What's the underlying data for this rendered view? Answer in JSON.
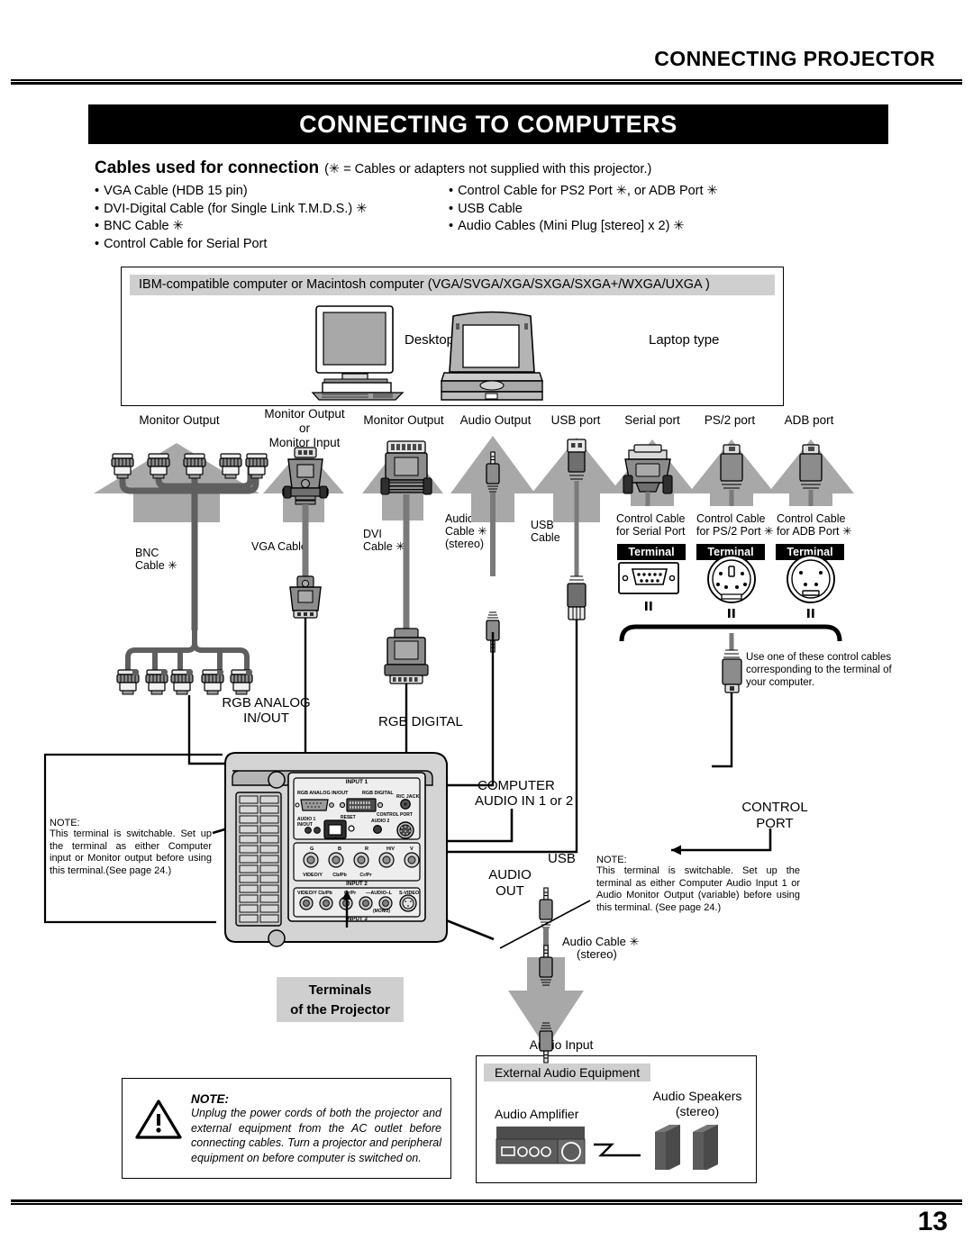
{
  "header": {
    "running_head": "CONNECTING PROJECTOR",
    "section_title": "CONNECTING TO COMPUTERS",
    "page_number": "13"
  },
  "cables": {
    "heading": "Cables used for connection",
    "note": "(✳ = Cables or adapters not supplied with this projector.)",
    "left_items": [
      "VGA Cable (HDB 15 pin)",
      "DVI-Digital Cable (for Single Link T.M.D.S.) ✳",
      "BNC Cable ✳",
      "Control Cable for Serial Port"
    ],
    "right_items": [
      "Control Cable for PS2 Port ✳, or ADB Port ✳",
      "USB Cable",
      "Audio Cables (Mini Plug [stereo] x 2) ✳"
    ]
  },
  "computers_box": {
    "caption": "IBM-compatible computer or Macintosh computer (VGA/SVGA/XGA/SXGA/SXGA+/WXGA/UXGA )",
    "desktop_label": "Desktop type",
    "laptop_label": "Laptop type"
  },
  "ports": [
    {
      "name": "Monitor Output"
    },
    {
      "name": "Monitor Output\nor\nMonitor Input"
    },
    {
      "name": "Monitor Output"
    },
    {
      "name": "Audio Output"
    },
    {
      "name": "USB port"
    },
    {
      "name": "Serial port"
    },
    {
      "name": "PS/2 port"
    },
    {
      "name": "ADB port"
    }
  ],
  "port_labels": {
    "monitor_output_1": "Monitor Output",
    "monitor_output_2_l1": "Monitor Output",
    "monitor_output_2_l2": "or",
    "monitor_output_2_l3": "Monitor Input",
    "monitor_output_3": "Monitor Output",
    "audio_output": "Audio Output",
    "usb_port": "USB port",
    "serial_port": "Serial port",
    "ps2_port": "PS/2 port",
    "adb_port": "ADB port"
  },
  "cable_captions": {
    "bnc_l1": "BNC",
    "bnc_l2": "Cable ✳",
    "vga": "VGA Cable",
    "dvi_l1": "DVI",
    "dvi_l2": "Cable ✳",
    "audio_l1": "Audio",
    "audio_l2": "Cable ✳",
    "audio_l3": "(stereo)",
    "usb_l1": "USB",
    "usb_l2": "Cable",
    "serial_l1": "Control Cable",
    "serial_l2": "for Serial Port",
    "ps2_l1": "Control Cable",
    "ps2_l2": "for PS/2 Port ✳",
    "adb_l1": "Control Cable",
    "adb_l2": "for ADB Port ✳",
    "terminal_tag": "Terminal",
    "audio_out_cable_l1": "Audio Cable ✳",
    "audio_out_cable_l2": "(stereo)"
  },
  "callouts": {
    "control_cable_note": "Use one of these control cables corresponding to the terminal of your computer.",
    "rgb_analog_l1": "RGB ANALOG",
    "rgb_analog_l2": "IN/OUT",
    "rgb_digital": "RGB DIGITAL",
    "computer_audio_l1": "COMPUTER",
    "computer_audio_l2": "AUDIO IN 1 or 2",
    "control_port_l1": "CONTROL",
    "control_port_l2": "PORT",
    "usb": "USB",
    "audio_out_l1": "AUDIO",
    "audio_out_l2": "OUT",
    "audio_input": "Audio Input",
    "terminals_chip_l1": "Terminals",
    "terminals_chip_l2": "of the Projector"
  },
  "notes": {
    "left_note_title": "NOTE:",
    "left_note_body": "This terminal is switchable. Set up the terminal as either Computer input or Monitor output before using this terminal.(See page 24.)",
    "right_note_title": "NOTE:",
    "right_note_body": "This terminal is switchable. Set up the terminal as either Computer Audio Input 1 or Audio Monitor Output (variable) before using this terminal. (See page 24.)",
    "bottom_note_title": "NOTE:",
    "bottom_note_body": "Unplug the power cords of both the projector and external equipment from the AC outlet before connecting cables. Turn a projector and peripheral equipment on before computer is switched on."
  },
  "projector_panel": {
    "input1": "INPUT 1",
    "rgb_analog_inout": "RGB ANALOG IN/OUT",
    "rgb_digital": "RGB DIGITAL",
    "rc_jack": "R/C JACK",
    "audio1_l1": "AUDIO 1",
    "audio1_l2": "IN/OUT",
    "reset": "RESET",
    "audio2": "AUDIO 2",
    "control_port": "CONTROL PORT",
    "bnc_g": "G",
    "bnc_b": "B",
    "bnc_r": "R",
    "bnc_hv": "H/V",
    "bnc_v": "V",
    "row_video": "VIDEO/Y   Cb/Pb    Cr/Pr",
    "input2": "INPUT 2",
    "input3": "INPUT 3",
    "in3_video": "VIDEO/Y Cb/Pb    Cr/Pr",
    "in3_audio": "—AUDIO–L",
    "in3_mono": "(MONO)",
    "s_video": "S-VIDEO"
  },
  "audio_equipment": {
    "box_title": "External Audio Equipment",
    "amplifier": "Audio Amplifier",
    "speakers_l1": "Audio Speakers",
    "speakers_l2": "(stereo)"
  },
  "colors": {
    "arrow_gray": "#a8a8a8",
    "chip_gray": "#cfcfcf",
    "connector_dark": "#6b6b6b",
    "connector_mid": "#8c8c8c",
    "body_gray": "#b4b4b4",
    "black": "#000000"
  }
}
